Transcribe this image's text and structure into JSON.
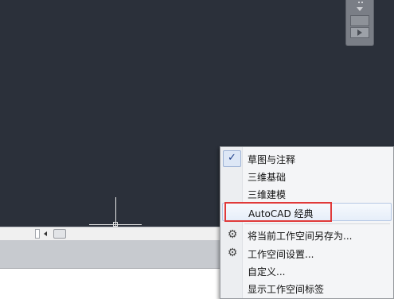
{
  "navigation_bar": {
    "icon": "play-icon"
  },
  "menu": {
    "items": [
      {
        "label": "草图与注释",
        "checked": true
      },
      {
        "label": "三维基础"
      },
      {
        "label": "三维建模"
      },
      {
        "label": "AutoCAD 经典",
        "highlighted": true
      },
      {
        "label": "将当前工作空间另存为...",
        "icon": "gear-save-icon"
      },
      {
        "label": "工作空间设置...",
        "icon": "gear-icon"
      },
      {
        "label": "自定义..."
      },
      {
        "label": "显示工作空间标签"
      }
    ]
  },
  "colors": {
    "canvas": "#2b303a",
    "highlight_box": "#e03a3a",
    "check": "#1f3f8a"
  }
}
